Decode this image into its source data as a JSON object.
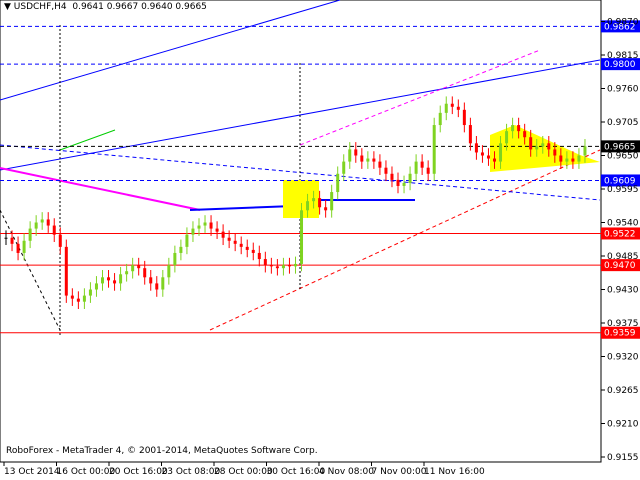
{
  "header": {
    "symbol": "USDCHF,H4",
    "ohlc": "0.9641 0.9667 0.9640 0.9665"
  },
  "footer": {
    "copyright": "RoboForex - MetaTrader 4, © 2001-2014, MetaQuotes Software Corp."
  },
  "colors": {
    "bull": "#7fd321",
    "bear": "#ff0000",
    "support": "#ff0000",
    "resistance": "#0000ff",
    "triangle": "#ffff00",
    "trend_magenta": "#ff00ff"
  },
  "chart_data": {
    "type": "candlestick",
    "title": "USDCHF,H4",
    "ylim": [
      0.914,
      0.9885
    ],
    "y_ticks": [
      "0.9870",
      "0.9815",
      "0.9760",
      "0.9705",
      "0.9650",
      "0.9595",
      "0.9540",
      "0.9485",
      "0.9430",
      "0.9375",
      "0.9320",
      "0.9265",
      "0.9210",
      "0.9155"
    ],
    "x_ticks": [
      "13 Oct 2014",
      "16 Oct 00:00",
      "20 Oct 16:00",
      "23 Oct 08:00",
      "28 Oct 00:00",
      "30 Oct 16:00",
      "4 Nov 08:00",
      "7 Nov 00:00",
      "11 Nov 16:00"
    ],
    "closes": [
      0.9515,
      0.9505,
      0.949,
      0.951,
      0.953,
      0.954,
      0.9545,
      0.9535,
      0.952,
      0.95,
      0.942,
      0.9415,
      0.941,
      0.942,
      0.943,
      0.944,
      0.945,
      0.9445,
      0.944,
      0.9455,
      0.946,
      0.947,
      0.9465,
      0.945,
      0.944,
      0.943,
      0.945,
      0.947,
      0.949,
      0.95,
      0.952,
      0.953,
      0.9535,
      0.954,
      0.953,
      0.9525,
      0.9515,
      0.951,
      0.9505,
      0.95,
      0.9495,
      0.949,
      0.948,
      0.947,
      0.9468,
      0.9465,
      0.947,
      0.9468,
      0.9472,
      0.956,
      0.9575,
      0.958,
      0.9565,
      0.956,
      0.959,
      0.962,
      0.964,
      0.966,
      0.965,
      0.964,
      0.9645,
      0.964,
      0.963,
      0.962,
      0.961,
      0.96,
      0.9605,
      0.962,
      0.964,
      0.963,
      0.962,
      0.97,
      0.972,
      0.9735,
      0.973,
      0.9725,
      0.97,
      0.967,
      0.9655,
      0.965,
      0.9645,
      0.964,
      0.967,
      0.969,
      0.97,
      0.969,
      0.968,
      0.966,
      0.9665,
      0.967,
      0.966,
      0.965,
      0.964,
      0.9645,
      0.964,
      0.965,
      0.9665
    ],
    "price_levels": [
      {
        "value": "0.9862",
        "color": "#0000ff"
      },
      {
        "value": "0.9800",
        "color": "#0000ff"
      },
      {
        "value": "0.9665",
        "color": "#000000"
      },
      {
        "value": "0.9609",
        "color": "#0000ff"
      },
      {
        "value": "0.9522",
        "color": "#ff0000"
      },
      {
        "value": "0.9470",
        "color": "#ff0000"
      },
      {
        "value": "0.9359",
        "color": "#ff0000"
      }
    ]
  }
}
